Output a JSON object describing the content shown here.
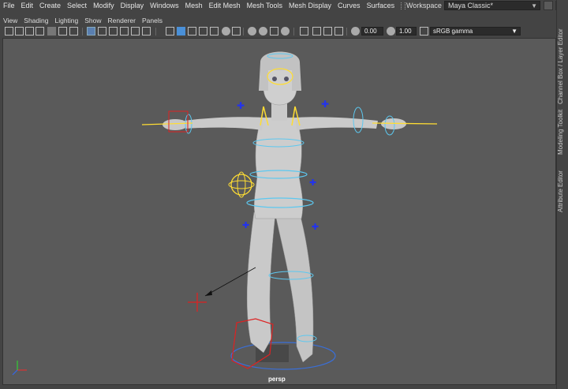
{
  "menu": [
    "File",
    "Edit",
    "Create",
    "Select",
    "Modify",
    "Display",
    "Windows",
    "Mesh",
    "Edit Mesh",
    "Mesh Tools",
    "Mesh Display",
    "Curves",
    "Surfaces"
  ],
  "workspace": {
    "label": "Workspace :",
    "value": "Maya Classic*"
  },
  "panel_menu": [
    "View",
    "Shading",
    "Lighting",
    "Show",
    "Renderer",
    "Panels"
  ],
  "toolbar": {
    "field1": "0.00",
    "field2": "1.00",
    "colorspace": "sRGB gamma"
  },
  "side_tabs": [
    "Channel Box / Layer Editor",
    "Modeling Toolkit",
    "Attribute Editor"
  ],
  "viewport": {
    "camera": "persp"
  }
}
